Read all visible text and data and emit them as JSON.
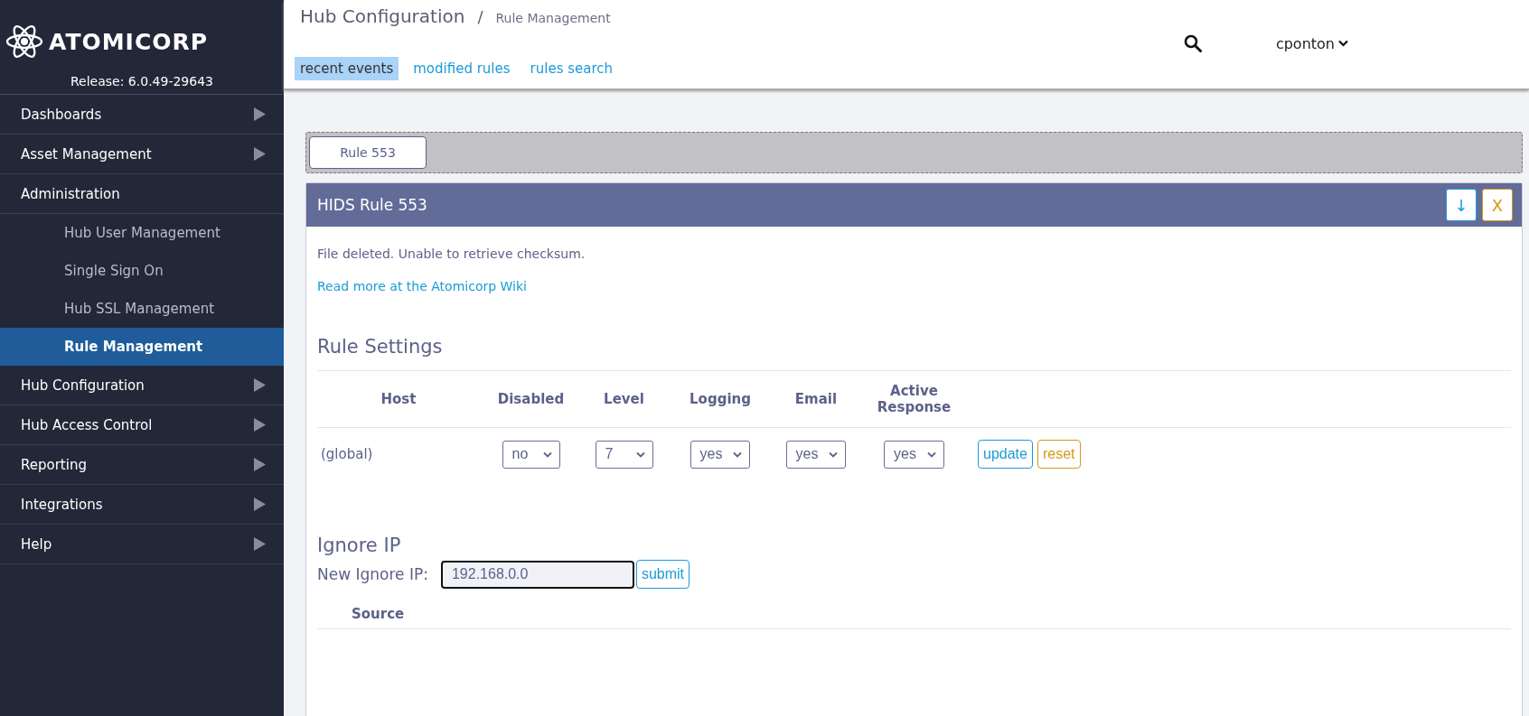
{
  "sidebar": {
    "logo": "ATOMICORP",
    "release": "Release: 6.0.49-29643",
    "items": [
      {
        "label": "Dashboards",
        "expanded": false
      },
      {
        "label": "Asset Management",
        "expanded": false
      },
      {
        "label": "Administration",
        "expanded": true,
        "children": [
          {
            "label": "Hub User Management",
            "selected": false
          },
          {
            "label": "Single Sign On",
            "selected": false
          },
          {
            "label": "Hub SSL Management",
            "selected": false
          },
          {
            "label": "Rule Management",
            "selected": true
          }
        ]
      },
      {
        "label": "Hub Configuration",
        "expanded": false
      },
      {
        "label": "Hub Access Control",
        "expanded": false
      },
      {
        "label": "Reporting",
        "expanded": false
      },
      {
        "label": "Integrations",
        "expanded": false
      },
      {
        "label": "Help",
        "expanded": false
      }
    ]
  },
  "header": {
    "breadcrumb": [
      "Hub Configuration",
      "Rule Management"
    ],
    "separator": "/",
    "tabs": [
      {
        "label": "recent events",
        "selected": true
      },
      {
        "label": "modified rules",
        "selected": false
      },
      {
        "label": "rules search",
        "selected": false
      }
    ],
    "user": "cponton"
  },
  "rule_tabs": [
    {
      "label": "Rule 553",
      "selected": true
    }
  ],
  "panel": {
    "title": "HIDS Rule 553",
    "buttons": [
      {
        "label": "↓",
        "kind": "primary"
      },
      {
        "label": "X",
        "kind": "warning"
      }
    ],
    "description": "File deleted. Unable to retrieve checksum.",
    "link": "Read more at the Atomicorp Wiki",
    "settings_heading": "Rule Settings",
    "columns": [
      "Host",
      "Disabled",
      "Level",
      "Logging",
      "Email",
      "Active Response"
    ],
    "rows": [
      {
        "host": "(global)",
        "values": [
          "no",
          "7",
          "yes",
          "yes",
          "yes"
        ],
        "actions": [
          {
            "label": "update",
            "kind": "primary"
          },
          {
            "label": "reset",
            "kind": "warning"
          }
        ]
      }
    ],
    "ignore_heading": "Ignore IP",
    "ignore_label": "New Ignore IP:",
    "ignore_value": "192.168.0.0",
    "submit": "submit",
    "ignore_columns": [
      "Source"
    ]
  }
}
